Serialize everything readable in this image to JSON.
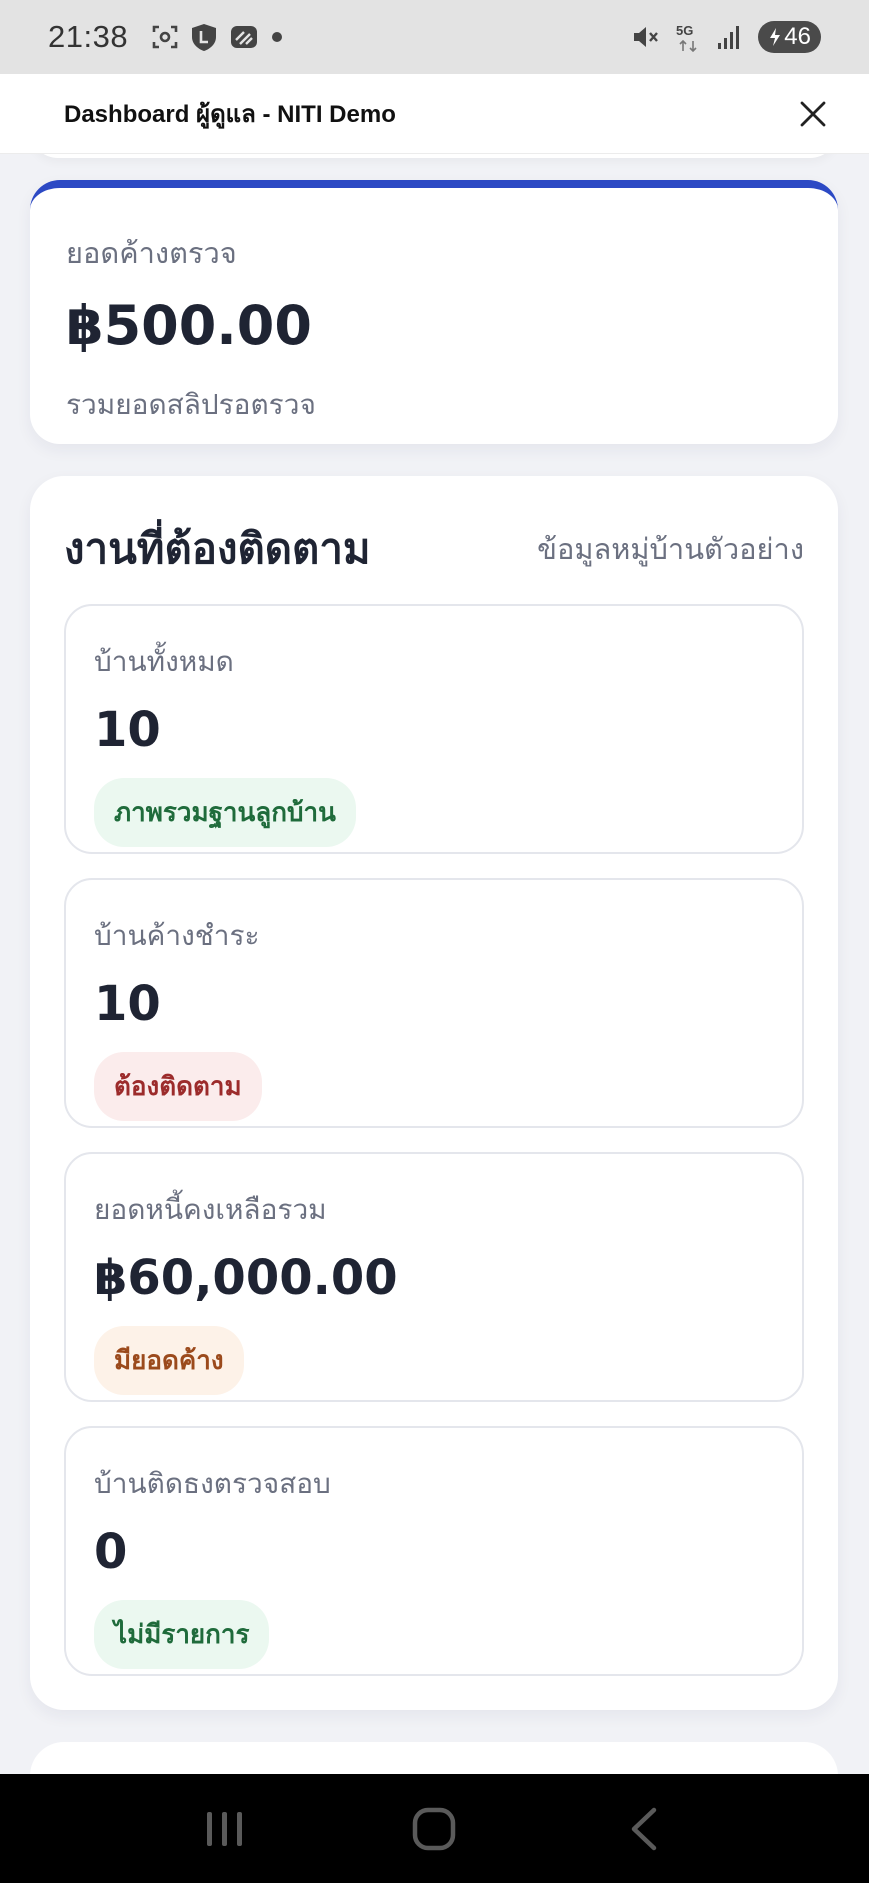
{
  "status": {
    "time": "21:38",
    "battery": "46",
    "network": "5G"
  },
  "titlebar": {
    "title": "Dashboard ผู้ดูแล - NITI Demo"
  },
  "summary": {
    "label": "ยอดค้างตรวจ",
    "value": "฿500.00",
    "sub": "รวมยอดสลิปรอตรวจ"
  },
  "followup": {
    "title": "งานที่ต้องติดตาม",
    "link": "ข้อมูลหมู่บ้านตัวอย่าง",
    "items": [
      {
        "label": "บ้านทั้งหมด",
        "value": "10",
        "badge": "ภาพรวมฐานลูกบ้าน",
        "badge_tone": "green"
      },
      {
        "label": "บ้านค้างชำระ",
        "value": "10",
        "badge": "ต้องติดตาม",
        "badge_tone": "red"
      },
      {
        "label": "ยอดหนี้คงเหลือรวม",
        "value": "฿60,000.00",
        "badge": "มียอดค้าง",
        "badge_tone": "orange"
      },
      {
        "label": "บ้านติดธงตรวจสอบ",
        "value": "0",
        "badge": "ไม่มีรายการ",
        "badge_tone": "green"
      }
    ]
  },
  "icons": {
    "close": "close-icon",
    "nav_recents": "recents-icon",
    "nav_home": "home-icon",
    "nav_back": "back-icon"
  },
  "colors": {
    "accent": "#2c49c4",
    "badge_green_bg": "#ebf8f0",
    "badge_green_text": "#1f6b3b",
    "badge_red_bg": "#fbecec",
    "badge_red_text": "#9c2b2b",
    "badge_orange_bg": "#fdf2e8",
    "badge_orange_text": "#9b4a1c"
  }
}
